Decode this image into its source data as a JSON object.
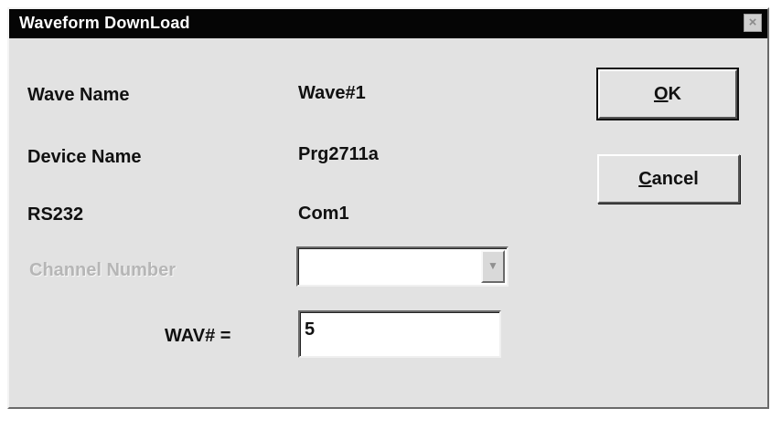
{
  "window": {
    "title": "Waveform DownLoad",
    "close_glyph": "×"
  },
  "fields": {
    "wave_name_label": "Wave Name",
    "wave_name_value": "Wave#1",
    "device_name_label": "Device Name",
    "device_name_value": "Prg2711a",
    "rs232_label": "RS232",
    "rs232_value": "Com1",
    "channel_number_label": "Channel Number",
    "channel_number_value": "",
    "wav_label": "WAV# =",
    "wav_value": "5"
  },
  "buttons": {
    "ok_mnemonic": "O",
    "ok_rest": "K",
    "cancel_mnemonic": "C",
    "cancel_rest": "ancel"
  },
  "icons": {
    "close": "close-icon",
    "dropdown": "chevron-down-icon"
  },
  "colors": {
    "titlebar": "#050505",
    "dialog_face": "#e2e2e2",
    "disabled_text": "#b6b6b6"
  }
}
